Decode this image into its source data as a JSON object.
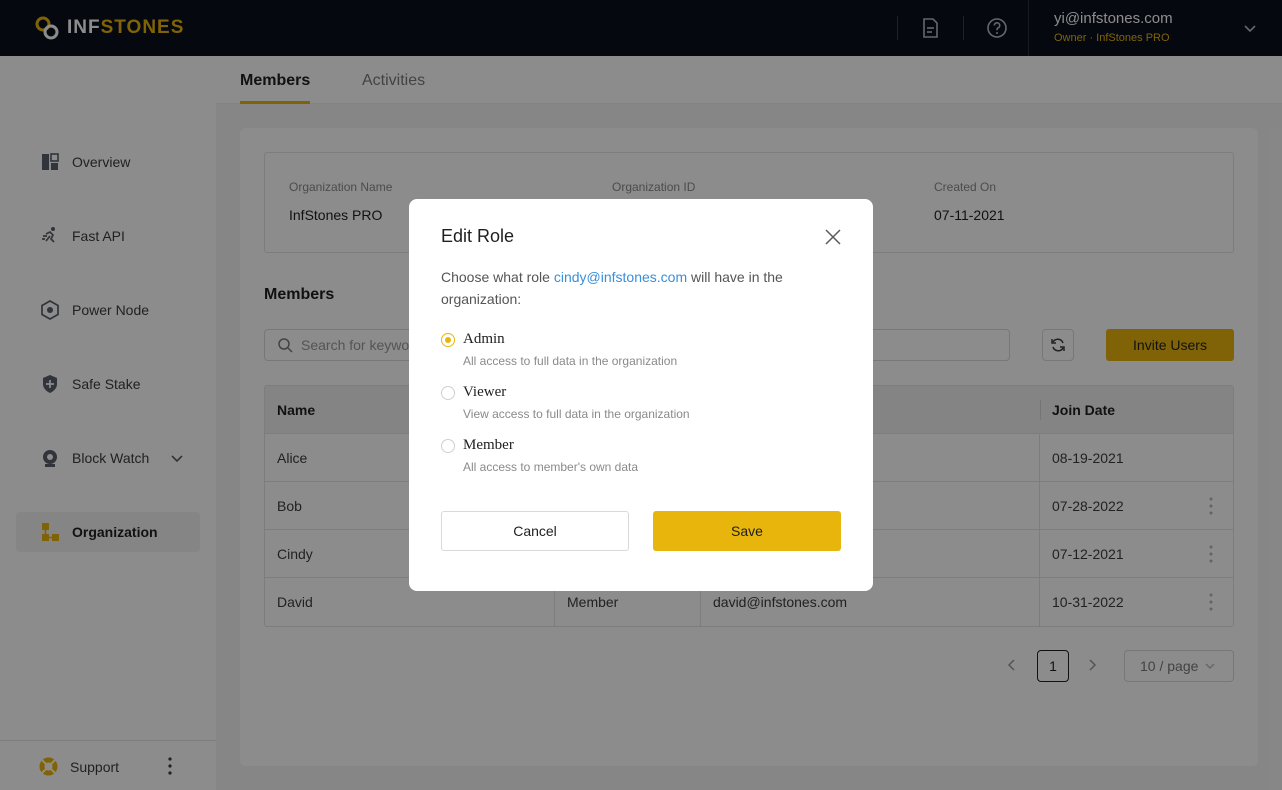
{
  "header": {
    "logo_text_a": "INF",
    "logo_text_b": "STONES",
    "user_email": "yi@infstones.com",
    "user_role": "Owner · InfStones PRO",
    "icons": [
      "document-icon",
      "help-icon",
      "chevron-down-icon"
    ]
  },
  "sidebar": {
    "items": [
      {
        "label": "Overview",
        "icon": "dashboard-icon"
      },
      {
        "label": "Fast API",
        "icon": "running-icon"
      },
      {
        "label": "Power Node",
        "icon": "node-icon"
      },
      {
        "label": "Safe Stake",
        "icon": "shield-icon"
      },
      {
        "label": "Block Watch",
        "icon": "watch-icon"
      },
      {
        "label": "Organization",
        "icon": "organization-icon",
        "active": true
      }
    ],
    "support_label": "Support"
  },
  "tabs": [
    {
      "label": "Members",
      "active": true
    },
    {
      "label": "Activities",
      "active": false
    }
  ],
  "org": {
    "name_label": "Organization Name",
    "name_value": "InfStones PRO",
    "id_label": "Organization ID",
    "created_label": "Created On",
    "created_value": "07-11-2021"
  },
  "members": {
    "title": "Members",
    "search_placeholder": "Search for keywords",
    "invite_label": "Invite Users",
    "columns": {
      "name": "Name",
      "join_date": "Join Date"
    },
    "rows": [
      {
        "name": "Alice",
        "role": "",
        "email": "",
        "join_date": "08-19-2021"
      },
      {
        "name": "Bob",
        "role": "",
        "email": "",
        "join_date": "07-28-2022"
      },
      {
        "name": "Cindy",
        "role": "",
        "email": "",
        "join_date": "07-12-2021"
      },
      {
        "name": "David",
        "role": "Member",
        "email": "david@infstones.com",
        "join_date": "10-31-2022"
      }
    ]
  },
  "pagination": {
    "current_page": "1",
    "page_size": "10 / page"
  },
  "modal": {
    "title": "Edit Role",
    "desc_before": "Choose what role ",
    "desc_email": "cindy@infstones.com",
    "desc_after": " will have in the organization:",
    "options": [
      {
        "label": "Admin",
        "desc": "All access to full data in the organization",
        "selected": true
      },
      {
        "label": "Viewer",
        "desc": "View access to full data in the organization",
        "selected": false
      },
      {
        "label": "Member",
        "desc": "All access to member's own data",
        "selected": false
      }
    ],
    "cancel_label": "Cancel",
    "save_label": "Save"
  },
  "colors": {
    "accent": "#e8b50c",
    "header_bg": "#0b0f1e",
    "link": "#3a8fd9"
  }
}
